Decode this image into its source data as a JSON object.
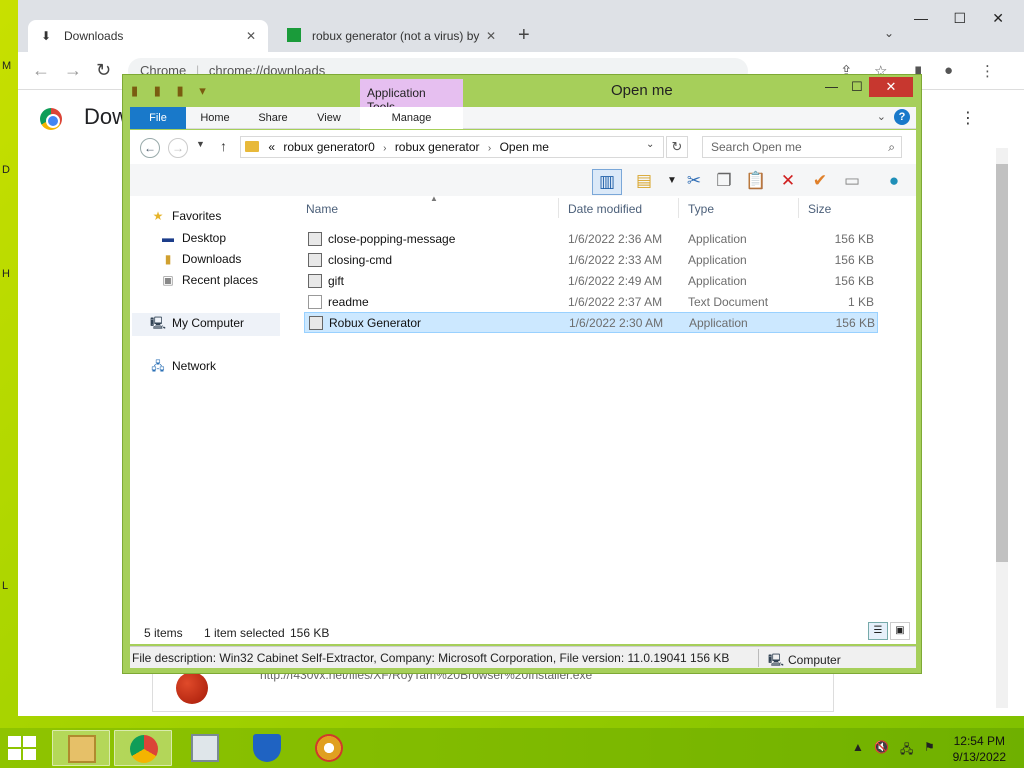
{
  "desktop": {
    "letters": [
      "M",
      "D",
      "H",
      "L"
    ]
  },
  "chrome": {
    "tabs": [
      {
        "title": "Downloads",
        "icon": "download-icon",
        "active": true
      },
      {
        "title": "robux generator (not a virus) by",
        "icon": "site-icon",
        "active": false
      }
    ],
    "omnibox_scheme": "Chrome",
    "omnibox_url": "chrome://downloads",
    "page_title": "Dow",
    "download_url": "http://f430vx.net/files/XF/RoyTam%20Browser%20Installer.exe"
  },
  "explorer": {
    "title": "Open me",
    "app_tools_label": "Application Tools",
    "ribbon_tabs": [
      "File",
      "Home",
      "Share",
      "View",
      "Manage"
    ],
    "breadcrumb": [
      "robux generator0",
      "robux generator",
      "Open me"
    ],
    "breadcrumb_prefix": "«",
    "search_placeholder": "Search Open me",
    "nav": {
      "favorites": "Favorites",
      "favorites_items": [
        "Desktop",
        "Downloads",
        "Recent places"
      ],
      "computer": "My Computer",
      "network": "Network"
    },
    "columns": {
      "name": "Name",
      "date": "Date modified",
      "type": "Type",
      "size": "Size"
    },
    "files": [
      {
        "name": "close-popping-message",
        "date": "1/6/2022 2:36 AM",
        "type": "Application",
        "size": "156 KB",
        "selected": false,
        "kind": "app"
      },
      {
        "name": "closing-cmd",
        "date": "1/6/2022 2:33 AM",
        "type": "Application",
        "size": "156 KB",
        "selected": false,
        "kind": "app"
      },
      {
        "name": "gift",
        "date": "1/6/2022 2:49 AM",
        "type": "Application",
        "size": "156 KB",
        "selected": false,
        "kind": "app"
      },
      {
        "name": "readme",
        "date": "1/6/2022 2:37 AM",
        "type": "Text Document",
        "size": "1 KB",
        "selected": false,
        "kind": "text"
      },
      {
        "name": "Robux Generator",
        "date": "1/6/2022 2:30 AM",
        "type": "Application",
        "size": "156 KB",
        "selected": true,
        "kind": "app"
      }
    ],
    "status": {
      "items": "5 items",
      "selected": "1 item selected",
      "selected_size": "156 KB"
    },
    "details": {
      "description": "File description: Win32 Cabinet Self-Extractor, Company: Microsoft Corporation, File version: 11.0.19041  156 KB",
      "location": "Computer"
    }
  },
  "taskbar": {
    "apps": [
      "file-explorer-icon",
      "chrome-icon",
      "task-manager-icon",
      "windows-defender-icon",
      "roytam-browser-icon"
    ],
    "time": "12:54 PM",
    "date": "9/13/2022"
  },
  "colors": {
    "desktop": "#a8d400",
    "explorer_frame": "#a6cf5a",
    "ribbon_file": "#1979ca",
    "selection": "#cce8ff",
    "close": "#c7372f"
  }
}
